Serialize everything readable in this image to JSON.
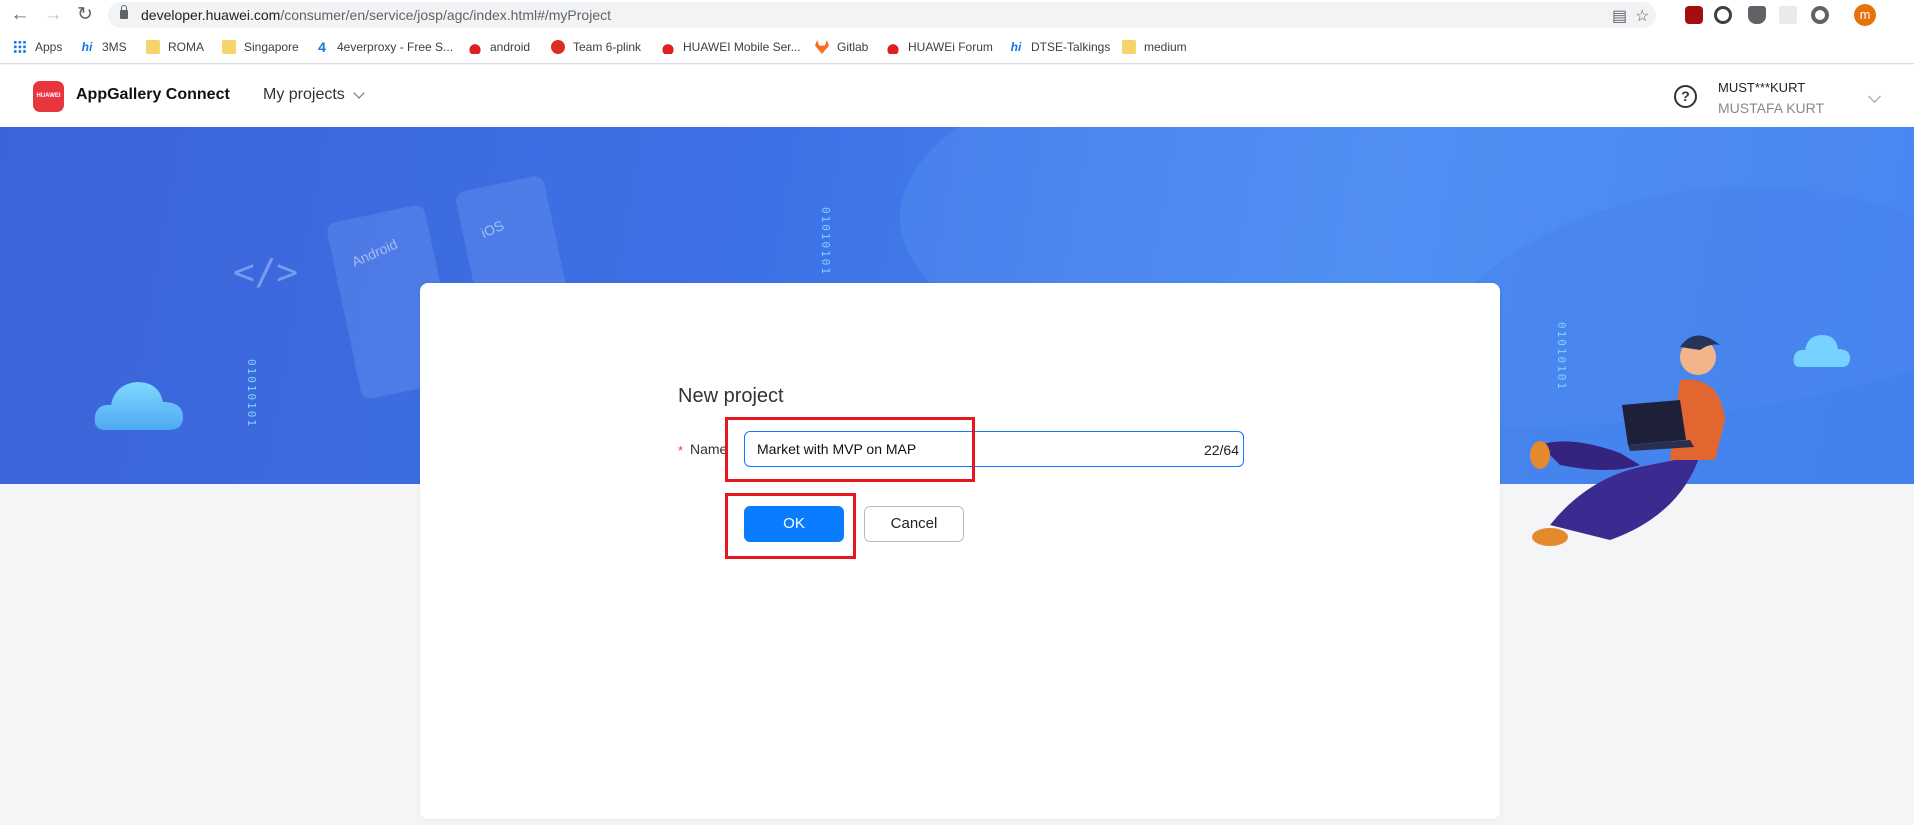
{
  "browser": {
    "url_host": "developer.huawei.com",
    "url_path": "/consumer/en/service/josp/agc/index.html#/myProject",
    "profile_initial": "m"
  },
  "bookmarks": [
    {
      "label": "Apps",
      "icon": "apps-grid-icon"
    },
    {
      "label": "3MS",
      "icon": "hi-icon"
    },
    {
      "label": "ROMA",
      "icon": "folder-icon"
    },
    {
      "label": "Singapore",
      "icon": "folder-icon"
    },
    {
      "label": "4everproxy - Free S...",
      "icon": "four-icon"
    },
    {
      "label": "android",
      "icon": "huawei-icon"
    },
    {
      "label": "Team 6-plink",
      "icon": "team-icon"
    },
    {
      "label": "HUAWEI Mobile Ser...",
      "icon": "huawei-icon"
    },
    {
      "label": "Gitlab",
      "icon": "gitlab-icon"
    },
    {
      "label": "HUAWEi Forum",
      "icon": "huawei-icon"
    },
    {
      "label": "DTSE-Talkings",
      "icon": "hi-icon"
    },
    {
      "label": "medium",
      "icon": "folder-icon"
    }
  ],
  "header": {
    "logo_text": "HUAWEI",
    "brand": "AppGallery Connect",
    "nav": "My projects",
    "help": "?",
    "user_masked": "MUST***KURT",
    "user_name": "MUSTAFA KURT"
  },
  "banner": {
    "binary_text": "01010101",
    "card_android": "Android",
    "card_ios": "iOS",
    "code_symbol": "</>"
  },
  "dialog": {
    "title": "New project",
    "required_mark": "*",
    "name_label": "Name",
    "name_value": "Market with MVP on MAP",
    "counter": "22/64",
    "ok_label": "OK",
    "cancel_label": "Cancel"
  },
  "colors": {
    "accent": "#0a7cff",
    "highlight": "#e6161f",
    "banner": "#3d72e6"
  }
}
